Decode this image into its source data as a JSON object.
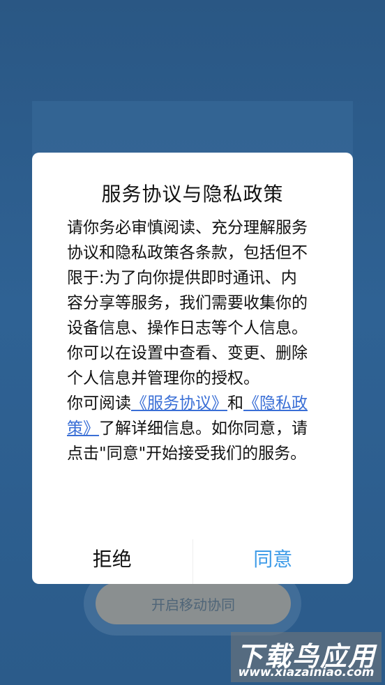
{
  "dialog": {
    "title": "服务协议与隐私政策",
    "para1": "请你务必审慎阅读、充分理解服务协议和隐私政策各条款，包括但不限于:为了向你提供即时通讯、内容分享等服务，我们需要收集你的设备信息、操作日志等个人信息。你可以在设置中查看、变更、删除个人信息并管理你的授权。",
    "para2_prefix": "你可阅读",
    "service_link": "《服务协议》",
    "and_text": "和",
    "privacy_link": "《隐私政策》",
    "para2_suffix": "了解详细信息。如你同意，请点击\"同意\"开始接受我们的服务。",
    "reject_label": "拒绝",
    "agree_label": "同意"
  },
  "background": {
    "start_button_label": "开启移动协同"
  },
  "watermark": {
    "title": "下载鸟应用",
    "url": "www.xiazainiao.com"
  },
  "colors": {
    "link": "#3a6fd6",
    "agree": "#3c9be8",
    "backdrop": "#2b5b8a"
  }
}
